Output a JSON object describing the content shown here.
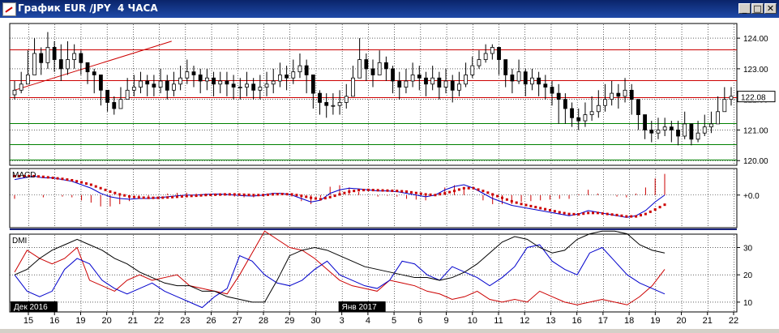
{
  "window": {
    "title": "График EUR /JPY  4 ЧАСА",
    "minimize_label": "_",
    "maximize_label": "□",
    "close_label": "✕"
  },
  "colors": {
    "bull": "#000000",
    "bear": "#000000",
    "resistance": "#cc0000",
    "support": "#008000",
    "macd_line": "#0000cc",
    "signal_dots": "#cc0000",
    "macd_hist": "#cc0000",
    "dmi_plus": "#0000cc",
    "dmi_minus": "#cc0000",
    "adx": "#000000"
  },
  "chart_data": [
    {
      "type": "candlestick",
      "name": "price",
      "y_ticks": [
        "124.00",
        "123.00",
        "122.00",
        "121.00",
        "120.00"
      ],
      "ylim": [
        119.9,
        124.4
      ],
      "current_price": "122.08",
      "horizontal_levels": [
        {
          "value": 123.62,
          "color": "#cc0000"
        },
        {
          "value": 122.62,
          "color": "#cc0000"
        },
        {
          "value": 122.08,
          "color": "#cc0000"
        },
        {
          "value": 121.22,
          "color": "#008000"
        },
        {
          "value": 120.53,
          "color": "#008000"
        },
        {
          "value": 120.03,
          "color": "#008000"
        }
      ],
      "trend_line": {
        "from": [
          0,
          122.3
        ],
        "to": [
          31,
          123.9
        ]
      },
      "close": [
        122.3,
        122.5,
        122.8,
        123.5,
        123.2,
        123.7,
        123.3,
        123.0,
        123.3,
        123.5,
        123.2,
        122.9,
        122.8,
        122.3,
        121.9,
        121.7,
        122.0,
        122.3,
        122.4,
        122.6,
        122.5,
        122.4,
        122.6,
        122.3,
        122.5,
        122.7,
        122.9,
        122.8,
        122.6,
        122.7,
        122.5,
        122.6,
        122.5,
        122.4,
        122.4,
        122.5,
        122.3,
        122.4,
        122.5,
        122.6,
        122.8,
        122.7,
        122.9,
        123.1,
        122.8,
        122.2,
        121.9,
        121.8,
        121.8,
        121.9,
        122.1,
        122.7,
        123.3,
        123.0,
        122.8,
        123.2,
        123.0,
        122.6,
        122.4,
        122.6,
        122.8,
        122.7,
        122.5,
        122.7,
        122.4,
        122.6,
        122.3,
        122.5,
        122.8,
        123.1,
        123.3,
        123.5,
        123.7,
        123.3,
        122.8,
        122.6,
        122.9,
        122.5,
        122.7,
        122.5,
        122.4,
        122.2,
        122.0,
        121.7,
        121.4,
        121.3,
        121.5,
        121.6,
        121.8,
        122.0,
        122.2,
        122.1,
        122.3,
        122.0,
        121.5,
        121.0,
        120.9,
        121.0,
        121.1,
        121.0,
        120.8,
        121.2,
        120.7,
        120.9,
        121.1,
        121.2,
        121.6,
        122.0,
        122.1
      ],
      "high": [
        122.6,
        122.9,
        123.6,
        124.0,
        123.7,
        124.2,
        123.9,
        123.8,
        123.9,
        123.8,
        123.6,
        123.2,
        123.0,
        122.6,
        122.2,
        122.1,
        122.4,
        122.7,
        122.8,
        122.9,
        122.8,
        122.8,
        123.0,
        122.8,
        122.9,
        123.1,
        123.3,
        123.1,
        123.0,
        123.0,
        122.9,
        122.9,
        122.9,
        122.8,
        122.7,
        122.9,
        122.7,
        122.8,
        122.9,
        123.0,
        123.2,
        123.1,
        123.3,
        123.5,
        123.3,
        122.7,
        122.3,
        122.2,
        122.2,
        122.3,
        122.5,
        123.1,
        124.0,
        123.5,
        123.3,
        123.6,
        123.4,
        123.1,
        122.9,
        123.0,
        123.2,
        123.1,
        122.9,
        123.1,
        122.9,
        123.0,
        122.8,
        122.9,
        123.2,
        123.4,
        123.6,
        123.8,
        123.8,
        123.7,
        123.3,
        123.0,
        123.3,
        123.0,
        123.0,
        122.9,
        122.8,
        122.6,
        122.5,
        122.2,
        121.9,
        121.7,
        121.9,
        122.1,
        122.3,
        122.5,
        122.6,
        122.5,
        122.7,
        122.5,
        122.0,
        121.5,
        121.3,
        121.4,
        121.4,
        121.3,
        121.3,
        121.6,
        121.2,
        121.3,
        121.5,
        121.6,
        122.1,
        122.4,
        122.4
      ],
      "low": [
        122.0,
        122.2,
        122.6,
        123.0,
        122.8,
        123.0,
        122.9,
        122.6,
        122.8,
        123.0,
        122.8,
        122.5,
        122.2,
        121.8,
        121.6,
        121.5,
        121.7,
        122.0,
        122.1,
        122.2,
        122.1,
        122.1,
        122.2,
        122.0,
        122.1,
        122.3,
        122.5,
        122.4,
        122.2,
        122.3,
        122.1,
        122.2,
        122.1,
        122.0,
        122.0,
        122.1,
        122.0,
        122.0,
        122.1,
        122.2,
        122.4,
        122.3,
        122.5,
        122.7,
        122.2,
        121.7,
        121.5,
        121.4,
        121.5,
        121.5,
        121.7,
        122.2,
        122.8,
        122.6,
        122.4,
        122.8,
        122.6,
        122.2,
        122.0,
        122.2,
        122.4,
        122.3,
        122.1,
        122.3,
        122.0,
        122.2,
        121.9,
        122.1,
        122.4,
        122.7,
        123.0,
        123.2,
        123.3,
        122.8,
        122.4,
        122.2,
        122.5,
        122.1,
        122.3,
        122.1,
        122.0,
        121.8,
        121.2,
        121.2,
        121.1,
        121.0,
        121.1,
        121.3,
        121.4,
        121.6,
        121.8,
        121.7,
        121.9,
        121.5,
        121.0,
        120.7,
        120.6,
        120.7,
        120.8,
        120.6,
        120.5,
        120.7,
        120.5,
        120.6,
        120.8,
        120.9,
        121.2,
        121.6,
        121.8
      ]
    },
    {
      "type": "line",
      "name": "MACD",
      "title": "MACD",
      "y_ticks": [
        "+0.0"
      ],
      "ylim": [
        -0.9,
        0.7
      ],
      "macd": [
        0.45,
        0.5,
        0.55,
        0.5,
        0.5,
        0.45,
        0.4,
        0.3,
        0.2,
        0.05,
        -0.05,
        -0.1,
        -0.12,
        -0.1,
        -0.1,
        -0.08,
        -0.05,
        -0.02,
        0.0,
        0.0,
        0.02,
        0.03,
        0.02,
        0.0,
        -0.02,
        -0.03,
        0.0,
        0.05,
        0.05,
        0.0,
        -0.1,
        -0.2,
        -0.15,
        0.05,
        0.15,
        0.2,
        0.18,
        0.15,
        0.12,
        0.12,
        0.1,
        0.05,
        0.0,
        -0.05,
        0.0,
        0.15,
        0.25,
        0.3,
        0.2,
        0.05,
        -0.1,
        -0.2,
        -0.3,
        -0.35,
        -0.4,
        -0.45,
        -0.5,
        -0.55,
        -0.6,
        -0.55,
        -0.45,
        -0.5,
        -0.55,
        -0.6,
        -0.65,
        -0.6,
        -0.45,
        -0.2,
        0.0
      ],
      "signal": [
        0.55,
        0.55,
        0.55,
        0.53,
        0.5,
        0.47,
        0.43,
        0.37,
        0.3,
        0.2,
        0.1,
        0.02,
        -0.04,
        -0.07,
        -0.08,
        -0.08,
        -0.07,
        -0.05,
        -0.03,
        -0.02,
        0.0,
        0.01,
        0.02,
        0.02,
        0.01,
        0.0,
        0.0,
        0.02,
        0.03,
        0.02,
        -0.02,
        -0.08,
        -0.12,
        -0.06,
        0.02,
        0.1,
        0.14,
        0.15,
        0.14,
        0.13,
        0.12,
        0.1,
        0.06,
        0.02,
        0.0,
        0.05,
        0.12,
        0.2,
        0.2,
        0.12,
        0.02,
        -0.08,
        -0.18,
        -0.26,
        -0.32,
        -0.38,
        -0.44,
        -0.5,
        -0.55,
        -0.56,
        -0.52,
        -0.52,
        -0.55,
        -0.58,
        -0.62,
        -0.62,
        -0.55,
        -0.42,
        -0.28
      ],
      "histogram": [
        -0.05,
        0.0,
        0.0,
        -0.03,
        0.0,
        -0.02,
        -0.03,
        -0.07,
        -0.1,
        -0.15,
        -0.15,
        -0.12,
        -0.08,
        -0.03,
        -0.02,
        0.0,
        0.02,
        0.03,
        0.03,
        0.02,
        0.02,
        0.02,
        0.0,
        -0.02,
        -0.03,
        -0.03,
        0.0,
        0.03,
        0.02,
        -0.02,
        -0.08,
        -0.12,
        -0.03,
        0.11,
        0.13,
        0.1,
        0.04,
        0.0,
        -0.02,
        -0.01,
        -0.02,
        -0.05,
        -0.06,
        -0.07,
        0.0,
        0.1,
        0.13,
        0.1,
        0.0,
        -0.07,
        -0.12,
        -0.12,
        -0.12,
        -0.09,
        -0.08,
        -0.07,
        -0.06,
        -0.05,
        -0.05,
        0.01,
        0.07,
        0.02,
        0.0,
        -0.02,
        -0.03,
        0.02,
        0.1,
        0.22,
        0.28
      ]
    },
    {
      "type": "line",
      "name": "DMI",
      "title": "DMI",
      "y_ticks": [
        "30",
        "20",
        "10"
      ],
      "ylim": [
        7,
        34
      ],
      "adx": [
        20,
        22,
        26,
        29,
        31,
        33,
        31,
        29,
        26,
        24,
        21,
        19,
        17,
        16,
        16,
        14,
        14,
        12,
        11,
        10,
        10,
        18,
        27,
        29,
        30,
        29,
        27,
        25,
        23,
        22,
        21,
        20,
        19,
        19,
        18,
        19,
        21,
        24,
        28,
        32,
        34,
        33,
        30,
        28,
        29,
        33,
        35,
        36,
        36,
        35,
        31,
        29,
        28
      ],
      "di_plus": [
        20,
        14,
        12,
        14,
        22,
        26,
        24,
        18,
        15,
        13,
        15,
        17,
        14,
        12,
        10,
        8,
        12,
        15,
        27,
        25,
        20,
        17,
        16,
        18,
        22,
        25,
        20,
        18,
        16,
        15,
        18,
        25,
        24,
        20,
        18,
        23,
        21,
        19,
        16,
        19,
        23,
        30,
        31,
        25,
        22,
        20,
        28,
        30,
        25,
        20,
        17,
        15,
        13
      ],
      "di_minus": [
        21,
        29,
        26,
        24,
        26,
        30,
        18,
        16,
        14,
        18,
        20,
        18,
        19,
        20,
        16,
        15,
        14,
        13,
        20,
        28,
        36,
        33,
        30,
        29,
        26,
        22,
        18,
        16,
        15,
        14,
        18,
        17,
        16,
        14,
        13,
        11,
        12,
        14,
        11,
        10,
        11,
        10,
        14,
        12,
        10,
        9,
        10,
        11,
        10,
        9,
        12,
        16,
        22
      ]
    }
  ],
  "x_axis": {
    "labels": [
      "15",
      "16",
      "19",
      "20",
      "21",
      "22",
      "23",
      "26",
      "27",
      "28",
      "29",
      "30",
      "3",
      "4",
      "5",
      "6",
      "9",
      "10",
      "11",
      "12",
      "13",
      "16",
      "17",
      "18",
      "19",
      "20",
      "21",
      "22"
    ],
    "month_markers": [
      {
        "label": "Дек 2016",
        "at_index": 0
      },
      {
        "label": "Янв 2017",
        "at_index": 12
      }
    ]
  }
}
